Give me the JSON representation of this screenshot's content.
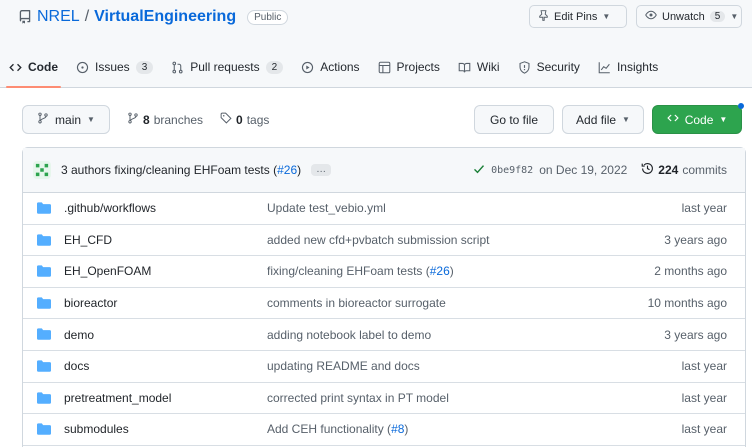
{
  "repo": {
    "owner": "NREL",
    "separator": "/",
    "name": "VirtualEngineering",
    "visibility": "Public"
  },
  "actions": {
    "edit_pins": "Edit Pins",
    "unwatch": "Unwatch",
    "unwatch_count": "5"
  },
  "tabs": [
    {
      "label": "Code",
      "icon": "code-icon",
      "active": true
    },
    {
      "label": "Issues",
      "count": "3",
      "icon": "issue-icon"
    },
    {
      "label": "Pull requests",
      "count": "2",
      "icon": "pull-request-icon"
    },
    {
      "label": "Actions",
      "icon": "play-icon"
    },
    {
      "label": "Projects",
      "icon": "table-icon"
    },
    {
      "label": "Wiki",
      "icon": "book-icon"
    },
    {
      "label": "Security",
      "icon": "shield-icon"
    },
    {
      "label": "Insights",
      "icon": "graph-icon"
    }
  ],
  "branch_bar": {
    "branch": "main",
    "branches_count": "8",
    "branches_label": "branches",
    "tags_count": "0",
    "tags_label": "tags",
    "go_to_file": "Go to file",
    "add_file": "Add file",
    "code": "Code"
  },
  "latest_commit": {
    "message": "3 authors fixing/cleaning EHFoam tests (",
    "pr_link": "#26",
    "message_end": ")",
    "ellipsis": "…",
    "sha": "0be9f82",
    "date": "on Dec 19, 2022",
    "commits_count": "224",
    "commits_label": "commits"
  },
  "files": [
    {
      "name": ".github/workflows",
      "message": "Update test_vebio.yml",
      "age": "last year"
    },
    {
      "name": "EH_CFD",
      "message": "added new cfd+pvbatch submission script",
      "age": "3 years ago"
    },
    {
      "name": "EH_OpenFOAM",
      "message": "fixing/cleaning EHFoam tests (",
      "link": "#26",
      "message_end": ")",
      "age": "2 months ago"
    },
    {
      "name": "bioreactor",
      "message": "comments in bioreactor surrogate",
      "age": "10 months ago"
    },
    {
      "name": "demo",
      "message": "adding notebook label to demo",
      "age": "3 years ago"
    },
    {
      "name": "docs",
      "message": "updating README and docs",
      "age": "last year"
    },
    {
      "name": "pretreatment_model",
      "message": "corrected print syntax in PT model",
      "age": "last year"
    },
    {
      "name": "submodules",
      "message": "Add CEH functionality (",
      "link": "#8",
      "message_end": ")",
      "age": "last year"
    }
  ],
  "colors": {
    "accent": "#0969da",
    "green": "#2da44e",
    "folder": "#54aeff",
    "tab_underline": "#fd8c73"
  }
}
